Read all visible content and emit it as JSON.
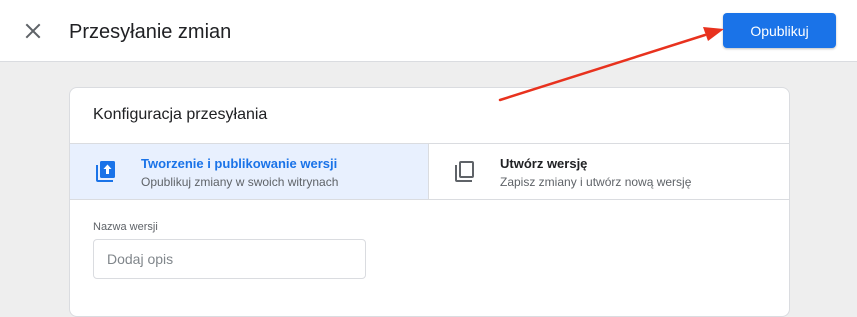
{
  "header": {
    "close_icon": "close-icon",
    "title": "Przesyłanie zmian",
    "publish_label": "Opublikuj"
  },
  "card": {
    "title": "Konfiguracja przesyłania",
    "options": [
      {
        "icon": "publish-icon",
        "title": "Tworzenie i publikowanie wersji",
        "description": "Opublikuj zmiany w swoich witrynach",
        "selected": true
      },
      {
        "icon": "copy-icon",
        "title": "Utwórz wersję",
        "description": "Zapisz zmiany i utwórz nową wersję",
        "selected": false
      }
    ],
    "version_name": {
      "label": "Nazwa wersji",
      "placeholder": "Dodaj opis",
      "value": ""
    }
  },
  "colors": {
    "accent": "#1a73e8",
    "selected_bg": "#e8f0fe",
    "annotation_arrow": "#e8321e"
  }
}
